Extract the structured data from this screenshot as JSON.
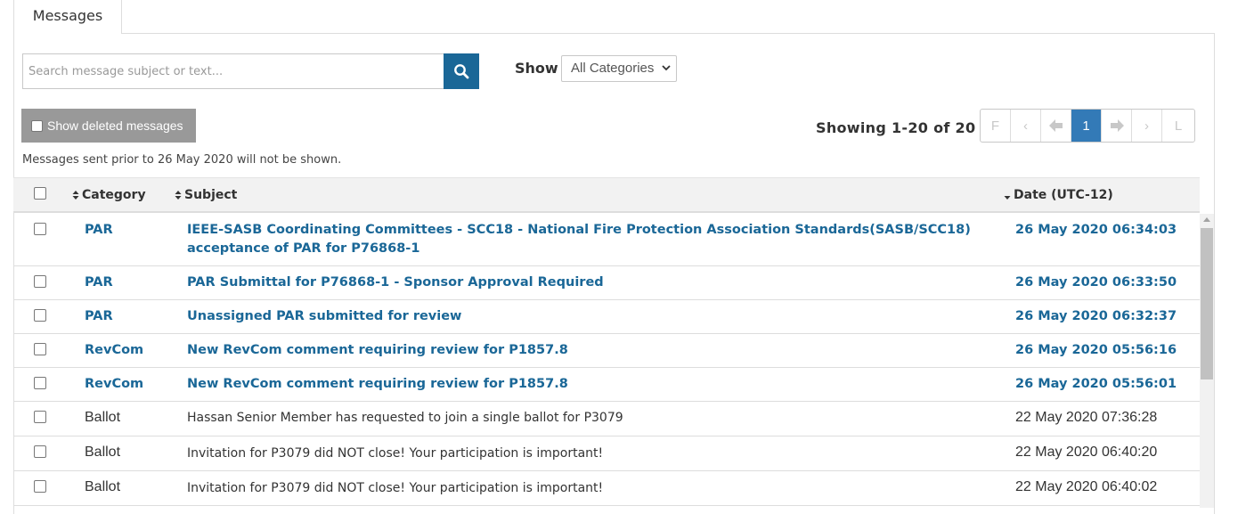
{
  "tabs": {
    "messages_label": "Messages"
  },
  "search": {
    "placeholder": "Search message subject or text..."
  },
  "filter": {
    "show_label": "Show",
    "category_selected": "All Categories"
  },
  "deleted_toggle": {
    "label": "Show deleted messages"
  },
  "pagination": {
    "showing_text": "Showing 1-20 of 20",
    "first": "F",
    "prev": "‹",
    "prev_arrow": "🡐",
    "current_page": "1",
    "next_arrow": "🡒",
    "next": "›",
    "last": "L"
  },
  "note": "Messages sent prior to 26 May 2020 will not be shown.",
  "table": {
    "headers": {
      "category": "Category",
      "subject": "Subject",
      "date": "Date (UTC-12)"
    },
    "rows": [
      {
        "category": "PAR",
        "subject": "IEEE-SASB Coordinating Committees - SCC18 - National Fire Protection Association Standards(SASB/SCC18) acceptance of PAR for P76868-1",
        "date": "26 May 2020 06:34:03",
        "unread": true
      },
      {
        "category": "PAR",
        "subject": "PAR Submittal for P76868-1 - Sponsor Approval Required",
        "date": "26 May 2020 06:33:50",
        "unread": true
      },
      {
        "category": "PAR",
        "subject": "Unassigned PAR submitted for review",
        "date": "26 May 2020 06:32:37",
        "unread": true
      },
      {
        "category": "RevCom",
        "subject": "New RevCom comment requiring review for P1857.8",
        "date": "26 May 2020 05:56:16",
        "unread": true
      },
      {
        "category": "RevCom",
        "subject": "New RevCom comment requiring review for P1857.8",
        "date": "26 May 2020 05:56:01",
        "unread": true
      },
      {
        "category": "Ballot",
        "subject": "Hassan Senior Member has requested to join a single ballot for P3079",
        "date": "22 May 2020 07:36:28",
        "unread": false
      },
      {
        "category": "Ballot",
        "subject": "Invitation for P3079 did NOT close! Your participation is important!",
        "date": "22 May 2020 06:40:20",
        "unread": false
      },
      {
        "category": "Ballot",
        "subject": "Invitation for P3079 did NOT close! Your participation is important!",
        "date": "22 May 2020 06:40:02",
        "unread": false
      }
    ]
  },
  "colors": {
    "accent": "#1a6797",
    "pager_active": "#337ab7",
    "deleted_button": "#999999"
  },
  "icons": {
    "search": "search-icon",
    "sort": "sort-icon",
    "sort_desc": "sort-desc-icon",
    "dropdown": "chevron-down-icon"
  }
}
